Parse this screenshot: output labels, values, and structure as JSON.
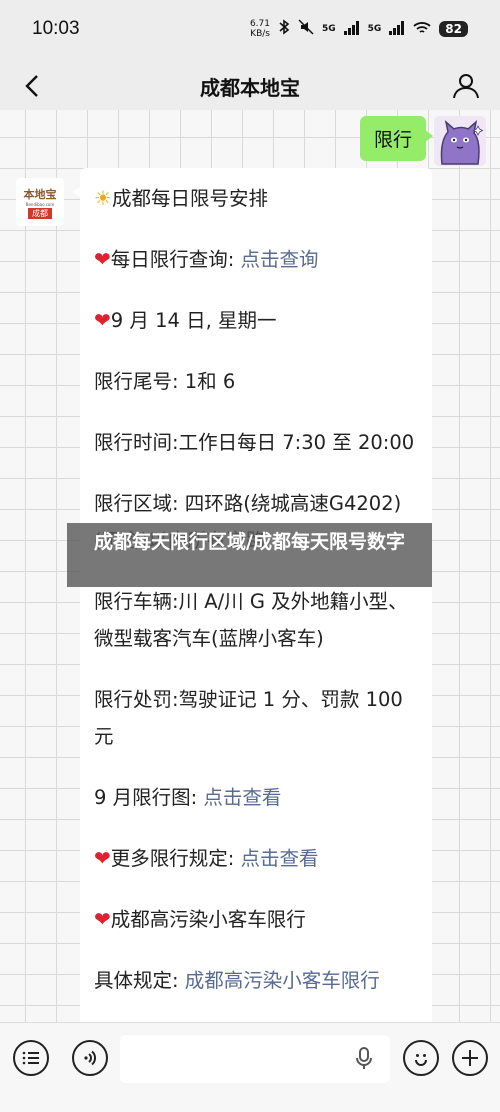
{
  "status_bar": {
    "time": "10:03",
    "net_speed_value": "6.71",
    "net_speed_unit": "KB/s",
    "signal_1": "5G",
    "signal_2": "5G",
    "battery": "82"
  },
  "nav": {
    "title": "成都本地宝"
  },
  "outgoing": {
    "text": "限行"
  },
  "bot_avatar": {
    "logo_name": "本地宝",
    "logo_url": "Bendibao.com",
    "logo_city": "成都"
  },
  "message": {
    "line1": "成都每日限号安排",
    "line2_label": "每日限行查询: ",
    "line2_link": "点击查询",
    "line3": "9 月 14 日, 星期一",
    "line4": "限行尾号: 1和 6",
    "line5": "限行时间:工作日每日 7:30 至 20:00",
    "line6": "限行区域: 四环路(绕城高速G4202)(不含)以内所有道路",
    "line7": "限行车辆:川 A/川 G 及外地籍小型、微型载客汽车(蓝牌小客车)",
    "line8": "限行处罚:驾驶证记 1 分、罚款 100 元",
    "line9_label": "9 月限行图: ",
    "line9_link": "点击查看",
    "line10_label": "更多限行规定: ",
    "line10_link": "点击查看",
    "line11": "成都高污染小客车限行",
    "line12_label": "具体规定: ",
    "line12_link": "成都高污染小客车限行"
  },
  "overlay": {
    "text": "成都每天限行区域/成都每天限号数字"
  },
  "colors": {
    "outgoing_bubble": "#95ec69",
    "link": "#576b95",
    "heart": "#e0212f"
  }
}
